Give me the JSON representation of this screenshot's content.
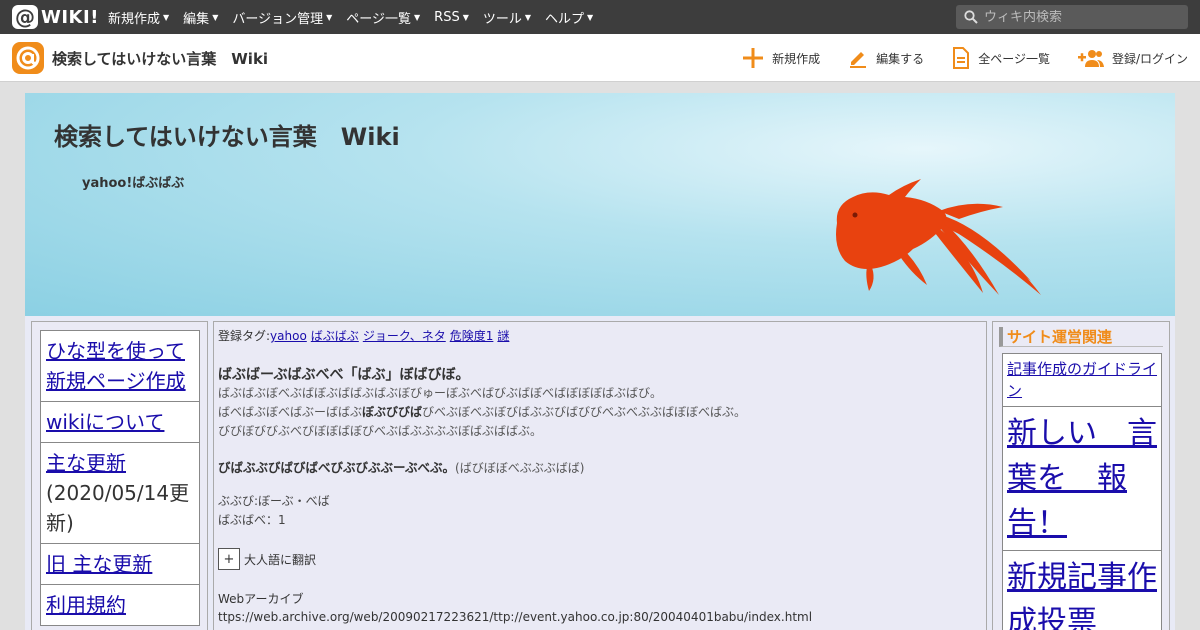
{
  "topbar": {
    "logo_text": "WIKI!",
    "menu": [
      {
        "label": "新規作成"
      },
      {
        "label": "編集"
      },
      {
        "label": "バージョン管理"
      },
      {
        "label": "ページ一覧"
      },
      {
        "label": "RSS"
      },
      {
        "label": "ツール"
      },
      {
        "label": "ヘルプ"
      }
    ],
    "search_placeholder": "ウィキ内検索"
  },
  "sitebar": {
    "title": "検索してはいけない言葉　Wiki",
    "actions": [
      {
        "label": "新規作成",
        "icon": "plus-icon"
      },
      {
        "label": "編集する",
        "icon": "pencil-icon"
      },
      {
        "label": "全ページ一覧",
        "icon": "document-icon"
      },
      {
        "label": "登録/ログイン",
        "icon": "add-user-icon"
      }
    ]
  },
  "banner": {
    "title": "検索してはいけない言葉　Wiki",
    "subtitle": "yahoo!ばぶばぶ"
  },
  "left_nav": {
    "items": [
      {
        "label": "ひな型を使って新規ページ作成"
      },
      {
        "label": "wikiについて"
      },
      {
        "label": "主な更新",
        "note": "(2020/05/14更新)"
      },
      {
        "label": "旧 主な更新"
      },
      {
        "label": "利用規約"
      }
    ]
  },
  "main": {
    "tags_label": "登録タグ:",
    "tags": [
      "yahoo",
      "ばぶばぶ",
      "ジョーク、ネタ",
      "危険度1",
      "謎"
    ],
    "heading": "ばぶばーぶばぶべべ「ばぶ」ぼばびぼ。",
    "para_line1": "ばぶばぶぼべぶばぼぶばばぶばぶぼびゅーぼぶべばびぶばぼべばぼぼぼばぶばび。",
    "para_line2_pre": "ばべばぶぼべばぶーばばぶ",
    "para_line2_bold": "ぼぶびびば",
    "para_line2_post": "びべぶぼべぶぼびばぶぶびばびびべぶべぶぶばぼぼべばぶ。",
    "para_line3": "びびぼびびぶべびぼぼばぼびべぶばぶぶぶぶぼばぶばばぶ。",
    "bold_line": "びばぶぶびばびばべびぶびぶぶーぶべぶ。",
    "bold_line_note": "(ばびぼぼべぶぶぶばば)",
    "line_a": "ぶぶび:ぼーぶ・べば",
    "line_b": "ばぶばべ：1",
    "toggle_symbol": "+",
    "toggle_label": "大人語に翻訳",
    "archive_label": "Webアーカイブ",
    "archive_url": "ttps://web.archive.org/web/20090217223621/ttp://event.yahoo.co.jp:80/20040401babu/index.html"
  },
  "right_nav": {
    "title": "サイト運営関連",
    "items": [
      {
        "label": "記事作成のガイドライン"
      },
      {
        "label": "新しい　言葉を　報告！"
      },
      {
        "label": "新規記事作成投票"
      }
    ]
  },
  "colors": {
    "topbar_bg": "#3d3d3d",
    "accent_orange": "#f08c1a",
    "link_blue": "#1a0dab",
    "banner_blue": "#8bd0e3",
    "goldfish_red": "#e8420f"
  }
}
